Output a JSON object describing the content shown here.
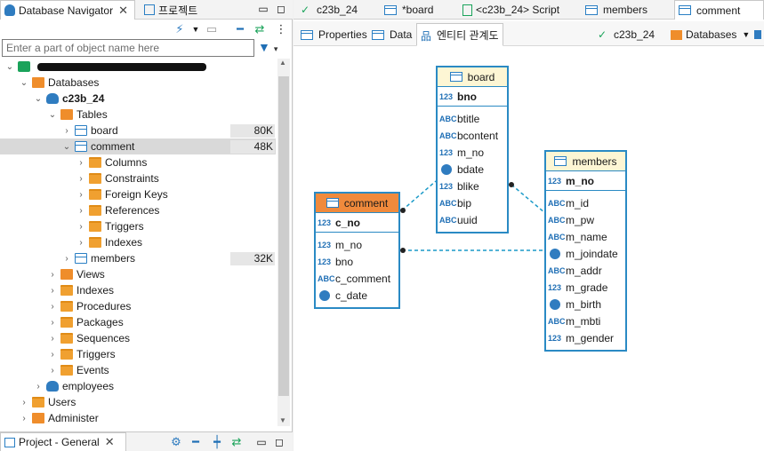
{
  "left_panel": {
    "tab_title": "Database Navigator",
    "tab2_title": "프로젝트",
    "filter_placeholder": "Enter a part of object name here",
    "tree": [
      {
        "label": "",
        "indent": 0,
        "arrow": "v",
        "icon": "db-conn"
      },
      {
        "label": "Databases",
        "indent": 1,
        "arrow": "v",
        "icon": "folder-o"
      },
      {
        "label": "c23b_24",
        "indent": 2,
        "arrow": "v",
        "icon": "db",
        "bold": true
      },
      {
        "label": "Tables",
        "indent": 3,
        "arrow": "v",
        "icon": "folder-o"
      },
      {
        "label": "board",
        "indent": 4,
        "arrow": ">",
        "icon": "tbl",
        "size": "80K"
      },
      {
        "label": "comment",
        "indent": 4,
        "arrow": "v",
        "icon": "tbl",
        "size": "48K",
        "selected": true
      },
      {
        "label": "Columns",
        "indent": 5,
        "arrow": ">",
        "icon": "folder"
      },
      {
        "label": "Constraints",
        "indent": 5,
        "arrow": ">",
        "icon": "folder"
      },
      {
        "label": "Foreign Keys",
        "indent": 5,
        "arrow": ">",
        "icon": "folder"
      },
      {
        "label": "References",
        "indent": 5,
        "arrow": ">",
        "icon": "folder"
      },
      {
        "label": "Triggers",
        "indent": 5,
        "arrow": ">",
        "icon": "folder"
      },
      {
        "label": "Indexes",
        "indent": 5,
        "arrow": ">",
        "icon": "folder"
      },
      {
        "label": "members",
        "indent": 4,
        "arrow": ">",
        "icon": "tbl",
        "size": "32K"
      },
      {
        "label": "Views",
        "indent": 3,
        "arrow": ">",
        "icon": "folder-o"
      },
      {
        "label": "Indexes",
        "indent": 3,
        "arrow": ">",
        "icon": "folder"
      },
      {
        "label": "Procedures",
        "indent": 3,
        "arrow": ">",
        "icon": "folder"
      },
      {
        "label": "Packages",
        "indent": 3,
        "arrow": ">",
        "icon": "folder"
      },
      {
        "label": "Sequences",
        "indent": 3,
        "arrow": ">",
        "icon": "folder"
      },
      {
        "label": "Triggers",
        "indent": 3,
        "arrow": ">",
        "icon": "folder"
      },
      {
        "label": "Events",
        "indent": 3,
        "arrow": ">",
        "icon": "folder"
      },
      {
        "label": "employees",
        "indent": 2,
        "arrow": ">",
        "icon": "db"
      },
      {
        "label": "Users",
        "indent": 1,
        "arrow": ">",
        "icon": "folder"
      },
      {
        "label": "Administer",
        "indent": 1,
        "arrow": ">",
        "icon": "folder-o"
      }
    ],
    "bottom_tab": "Project - General"
  },
  "editor": {
    "tabs": [
      "c23b_24",
      "*board",
      "<c23b_24> Script",
      "members",
      "comment"
    ],
    "active_tab": "comment",
    "subtabs": [
      "Properties",
      "Data",
      "엔티티 관계도"
    ],
    "active_subtab": "엔티티 관계도",
    "right_crumb_1": "c23b_24",
    "right_crumb_2": "Databases"
  },
  "er": {
    "board": {
      "name": "board",
      "pk": {
        "type": "123",
        "name": "bno"
      },
      "attrs": [
        {
          "type": "ABC",
          "name": "btitle"
        },
        {
          "type": "ABC",
          "name": "bcontent"
        },
        {
          "type": "123",
          "name": "m_no"
        },
        {
          "type": "clock",
          "name": "bdate"
        },
        {
          "type": "123",
          "name": "blike"
        },
        {
          "type": "ABC",
          "name": "bip"
        },
        {
          "type": "ABC",
          "name": "uuid"
        }
      ]
    },
    "comment": {
      "name": "comment",
      "pk": {
        "type": "123",
        "name": "c_no"
      },
      "attrs": [
        {
          "type": "123",
          "name": "m_no"
        },
        {
          "type": "123",
          "name": "bno"
        },
        {
          "type": "ABC",
          "name": "c_comment"
        },
        {
          "type": "clock",
          "name": "c_date"
        }
      ]
    },
    "members": {
      "name": "members",
      "pk": {
        "type": "123",
        "name": "m_no"
      },
      "attrs": [
        {
          "type": "ABC",
          "name": "m_id"
        },
        {
          "type": "ABC",
          "name": "m_pw"
        },
        {
          "type": "ABC",
          "name": "m_name"
        },
        {
          "type": "clock",
          "name": "m_joindate"
        },
        {
          "type": "ABC",
          "name": "m_addr"
        },
        {
          "type": "123",
          "name": "m_grade"
        },
        {
          "type": "clock",
          "name": "m_birth"
        },
        {
          "type": "ABC",
          "name": "m_mbti"
        },
        {
          "type": "123",
          "name": "m_gender"
        }
      ]
    }
  }
}
